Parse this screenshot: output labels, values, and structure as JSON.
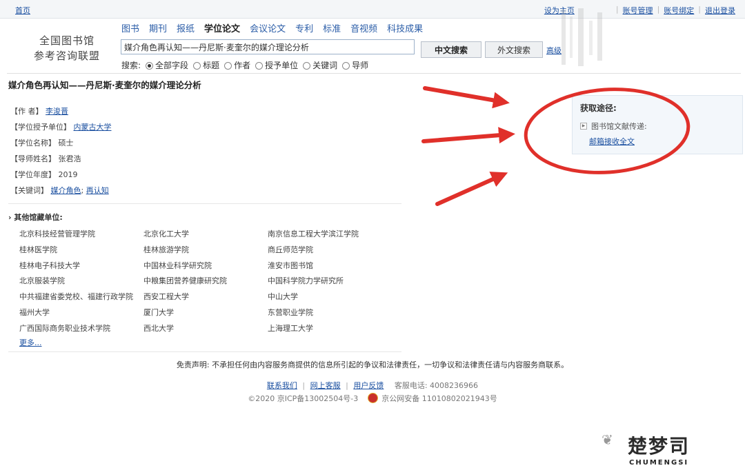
{
  "topbar": {
    "home": "首页",
    "links": [
      "设为主页",
      "账号管理",
      "账号绑定",
      "退出登录"
    ]
  },
  "logo": {
    "line1": "全国图书馆",
    "line2": "参考咨询联盟"
  },
  "nav": [
    "图书",
    "期刊",
    "报纸",
    "学位论文",
    "会议论文",
    "专利",
    "标准",
    "音视频",
    "科技成果"
  ],
  "nav_active": "学位论文",
  "search": {
    "value": "媒介角色再认知——丹尼斯·麦奎尔的媒介理论分析",
    "btn_cn": "中文搜索",
    "btn_en": "外文搜索",
    "advanced": "高级",
    "scope_label": "搜索:",
    "scopes": [
      "全部字段",
      "标题",
      "作者",
      "授予单位",
      "关键词",
      "导师"
    ],
    "scope_selected": "全部字段"
  },
  "record": {
    "title": "媒介角色再认知——丹尼斯·麦奎尔的媒介理论分析",
    "fields": [
      {
        "label": "【作 者】",
        "value": "李浚晋",
        "link": true
      },
      {
        "label": "【学位授予单位】",
        "value": "内蒙古大学",
        "link": true
      },
      {
        "label": "【学位名称】",
        "value": "硕士",
        "link": false
      },
      {
        "label": "【导师姓名】",
        "value": "张君浩",
        "link": false
      },
      {
        "label": "【学位年度】",
        "value": "2019",
        "link": false
      },
      {
        "label": "【关键词】",
        "value": "媒介角色",
        "value2": "再认知",
        "link": true
      }
    ]
  },
  "sidebox": {
    "title": "获取途径:",
    "item": "图书馆文献传递:",
    "link": "邮箱接收全文"
  },
  "holdings": {
    "title": "其他馆藏单位:",
    "rows": [
      [
        "北京科技经营管理学院",
        "北京化工大学",
        "南京信息工程大学滨江学院"
      ],
      [
        "桂林医学院",
        "桂林旅游学院",
        "商丘师范学院"
      ],
      [
        "桂林电子科技大学",
        "中国林业科学研究院",
        "淮安市图书馆"
      ],
      [
        "北京服装学院",
        "中粮集团营养健康研究院",
        "中国科学院力学研究所"
      ],
      [
        "中共福建省委党校、福建行政学院",
        "西安工程大学",
        "中山大学"
      ],
      [
        "福州大学",
        "厦门大学",
        "东营职业学院"
      ],
      [
        "广西国际商务职业技术学院",
        "西北大学",
        "上海理工大学"
      ]
    ],
    "more": "更多..."
  },
  "footer": {
    "disclaimer": "免责声明:  不承担任何由内容服务商提供的信息所引起的争议和法律责任，一切争议和法律责任请与内容服务商联系。",
    "links": [
      "联系我们",
      "网上客服",
      "用户反馈"
    ],
    "phone": "客服电话: 4008236966",
    "copyright": "©2020   京ICP备13002504号-3",
    "police": "京公网安备 11010802021943号"
  },
  "watermark": {
    "text": "楚梦司",
    "sub": "CHUMENGSI"
  },
  "colors": {
    "link": "#1a4fa0",
    "annotation": "#e0302a",
    "sidebox_bg": "#f3f7fb"
  }
}
